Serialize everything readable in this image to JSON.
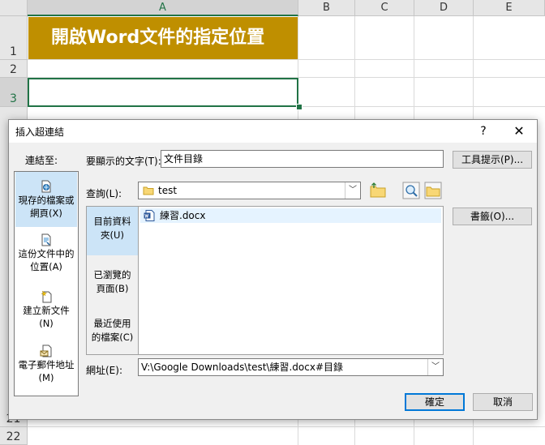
{
  "sheet": {
    "columns": [
      "A",
      "B",
      "C",
      "D",
      "E"
    ],
    "rows": [
      "1",
      "2",
      "3",
      "21",
      "22"
    ],
    "title_cell": "開啟Word文件的指定位置"
  },
  "dialog": {
    "title": "插入超連結",
    "help": "?",
    "close": "✕",
    "link_to_label": "連結至:",
    "link_to_items": [
      {
        "label_1": "現存的檔案或",
        "label_2": "網頁(X)",
        "icon": "web-page-file-icon"
      },
      {
        "label_1": "這份文件中的",
        "label_2": "位置(A)",
        "icon": "document-place-icon"
      },
      {
        "label_1": "建立新文件",
        "label_2": "(N)",
        "icon": "new-document-icon"
      },
      {
        "label_1": "電子郵件地址",
        "label_2": "(M)",
        "icon": "email-address-icon"
      }
    ],
    "display_text_label": "要顯示的文字(T):",
    "display_text_value": "文件目錄",
    "screentip_button": "工具提示(P)...",
    "look_in_label": "查詢(L):",
    "look_in_value": "test",
    "look_in_nav": [
      {
        "label_1": "目前資料",
        "label_2": "夾(U)"
      },
      {
        "label_1": "已瀏覽的",
        "label_2": "頁面(B)"
      },
      {
        "label_1": "最近使用",
        "label_2": "的檔案(C)"
      }
    ],
    "files": [
      "練習.docx"
    ],
    "bookmark_button": "書籤(O)...",
    "address_label": "網址(E):",
    "address_value": "V:\\Google Downloads\\test\\練習.docx#目錄",
    "ok_button": "確定",
    "cancel_button": "取消"
  },
  "colors": {
    "title_fill": "#bf8f00",
    "excel_green": "#217346",
    "selection_blue": "#cce4f7"
  }
}
